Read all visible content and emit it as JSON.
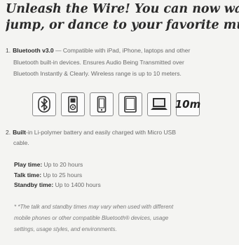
{
  "headline": {
    "line1": "Unleash the Wire! You can now walk,",
    "line2": "jump, or dance to your favorite music"
  },
  "feature1": {
    "number": "1.",
    "title": "Bluetooth v3.0",
    "line1": " — Compatible with iPad, iPhone, laptops and other",
    "line2": "Bluetooth built-in devices.  Ensures Audio Being Transmitted over",
    "line3": "Bluetooth Instantly & Clearly.  Wireless range is up to 10 meters."
  },
  "compat_icons": [
    "bluetooth-icon",
    "ipod-icon",
    "smartphone-icon",
    "tablet-icon",
    "laptop-icon"
  ],
  "range_badge": "10m",
  "feature2": {
    "number": "2.",
    "title": "Built",
    "line1": "-in Li-polymer battery and easily charged with Micro USB",
    "line2": "cable."
  },
  "times": {
    "play_label": "Play time:",
    "play_value": " Up to 20 hours",
    "talk_label": "Talk time:",
    "talk_value": " Up to 25 hours",
    "standby_label": "Standby time:",
    "standby_value": " Up to 1400 hours"
  },
  "note": {
    "line1": "* *The talk and standby times may vary when used with different",
    "line2": "mobile phones or other compatible Bluetooth® devices, usage",
    "line3": "settings, usage styles, and environments."
  }
}
